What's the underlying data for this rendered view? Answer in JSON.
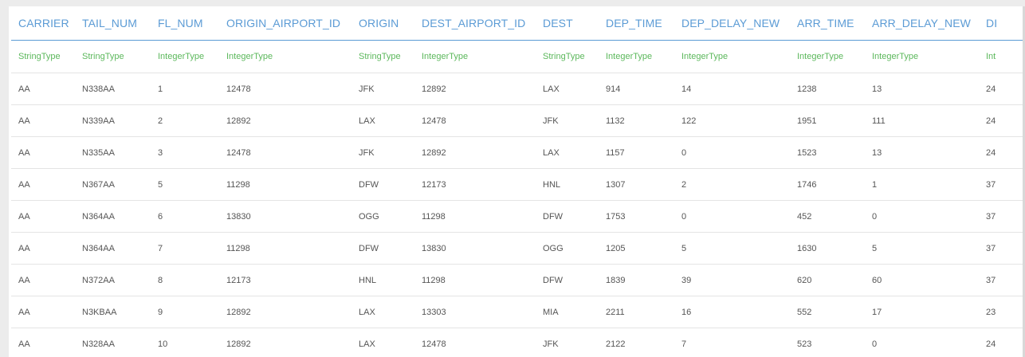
{
  "table": {
    "columns": [
      {
        "name": "CARRIER",
        "type": "StringType"
      },
      {
        "name": "TAIL_NUM",
        "type": "StringType"
      },
      {
        "name": "FL_NUM",
        "type": "IntegerType"
      },
      {
        "name": "ORIGIN_AIRPORT_ID",
        "type": "IntegerType"
      },
      {
        "name": "ORIGIN",
        "type": "StringType"
      },
      {
        "name": "DEST_AIRPORT_ID",
        "type": "IntegerType"
      },
      {
        "name": "DEST",
        "type": "StringType"
      },
      {
        "name": "DEP_TIME",
        "type": "IntegerType"
      },
      {
        "name": "DEP_DELAY_NEW",
        "type": "IntegerType"
      },
      {
        "name": "ARR_TIME",
        "type": "IntegerType"
      },
      {
        "name": "ARR_DELAY_NEW",
        "type": "IntegerType"
      },
      {
        "name": "DI",
        "type": "Int"
      }
    ],
    "rows": [
      [
        "AA",
        "N338AA",
        "1",
        "12478",
        "JFK",
        "12892",
        "LAX",
        "914",
        "14",
        "1238",
        "13",
        "24"
      ],
      [
        "AA",
        "N339AA",
        "2",
        "12892",
        "LAX",
        "12478",
        "JFK",
        "1132",
        "122",
        "1951",
        "111",
        "24"
      ],
      [
        "AA",
        "N335AA",
        "3",
        "12478",
        "JFK",
        "12892",
        "LAX",
        "1157",
        "0",
        "1523",
        "13",
        "24"
      ],
      [
        "AA",
        "N367AA",
        "5",
        "11298",
        "DFW",
        "12173",
        "HNL",
        "1307",
        "2",
        "1746",
        "1",
        "37"
      ],
      [
        "AA",
        "N364AA",
        "6",
        "13830",
        "OGG",
        "11298",
        "DFW",
        "1753",
        "0",
        "452",
        "0",
        "37"
      ],
      [
        "AA",
        "N364AA",
        "7",
        "11298",
        "DFW",
        "13830",
        "OGG",
        "1205",
        "5",
        "1630",
        "5",
        "37"
      ],
      [
        "AA",
        "N372AA",
        "8",
        "12173",
        "HNL",
        "11298",
        "DFW",
        "1839",
        "39",
        "620",
        "60",
        "37"
      ],
      [
        "AA",
        "N3KBAA",
        "9",
        "12892",
        "LAX",
        "13303",
        "MIA",
        "2211",
        "16",
        "552",
        "17",
        "23"
      ],
      [
        "AA",
        "N328AA",
        "10",
        "12892",
        "LAX",
        "12478",
        "JFK",
        "2122",
        "7",
        "523",
        "0",
        "24"
      ]
    ]
  }
}
